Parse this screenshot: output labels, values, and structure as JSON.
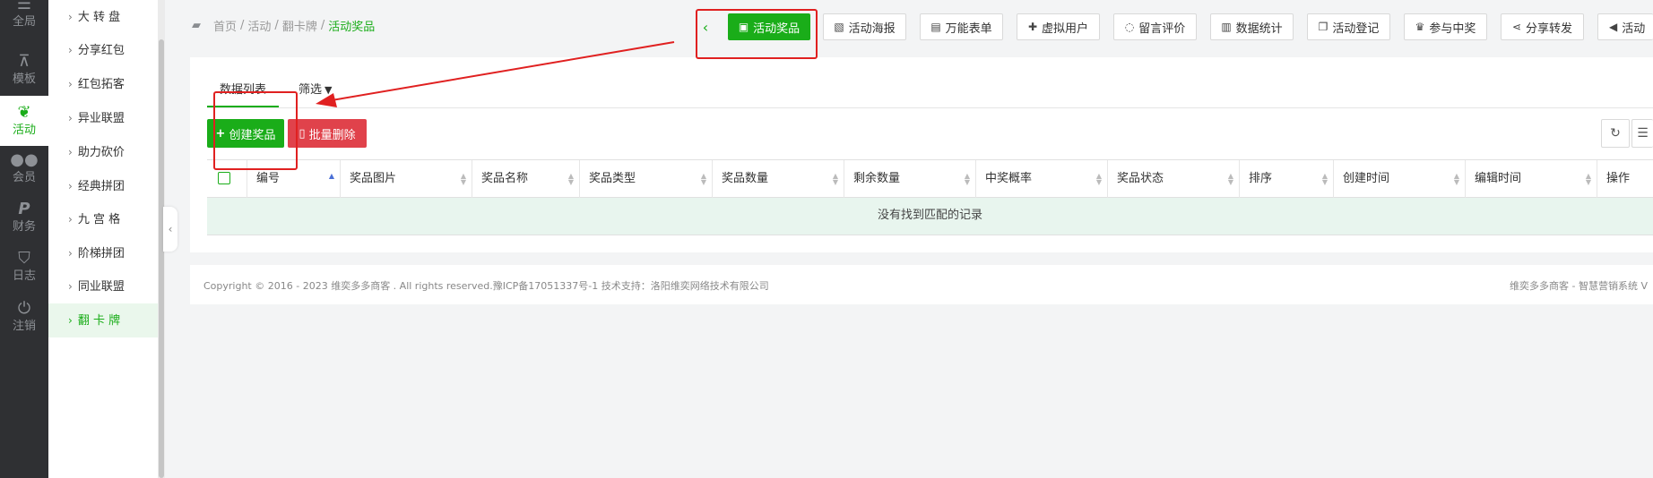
{
  "rail": {
    "items": [
      {
        "label": "全局",
        "icon": "sliders-icon"
      },
      {
        "label": "模板",
        "icon": "sitemap-icon"
      },
      {
        "label": "活动",
        "icon": "leaf-icon",
        "active": true
      },
      {
        "label": "会员",
        "icon": "users-icon"
      },
      {
        "label": "财务",
        "icon": "paypal-icon"
      },
      {
        "label": "日志",
        "icon": "shield-icon"
      },
      {
        "label": "注销",
        "icon": "power-icon"
      }
    ]
  },
  "submenu": {
    "items": [
      {
        "label": "大 转 盘"
      },
      {
        "label": "分享红包"
      },
      {
        "label": "红包拓客"
      },
      {
        "label": "异业联盟"
      },
      {
        "label": "助力砍价"
      },
      {
        "label": "经典拼团"
      },
      {
        "label": "九 宫 格"
      },
      {
        "label": "阶梯拼团"
      },
      {
        "label": "同业联盟"
      },
      {
        "label": "翻 卡 牌",
        "active": true
      }
    ]
  },
  "breadcrumb": {
    "items": [
      "首页",
      "活动",
      "翻卡牌"
    ],
    "current": "活动奖品"
  },
  "toolbar": {
    "buttons": [
      {
        "label": "活动奖品",
        "icon": "gift-icon",
        "active": true
      },
      {
        "label": "活动海报",
        "icon": "image-icon"
      },
      {
        "label": "万能表单",
        "icon": "file-icon"
      },
      {
        "label": "虚拟用户",
        "icon": "user-plus-icon"
      },
      {
        "label": "留言评价",
        "icon": "comment-icon"
      },
      {
        "label": "数据统计",
        "icon": "bar-chart-icon"
      },
      {
        "label": "活动登记",
        "icon": "copy-icon"
      },
      {
        "label": "参与中奖",
        "icon": "trophy-icon"
      },
      {
        "label": "分享转发",
        "icon": "share-icon"
      },
      {
        "label": "活动",
        "icon": "bullhorn-icon"
      }
    ]
  },
  "tabs": {
    "data_list": "数据列表",
    "filter": "筛选"
  },
  "actions": {
    "create": "创建奖品",
    "batch_delete": "批量删除"
  },
  "table": {
    "columns": [
      "编号",
      "奖品图片",
      "奖品名称",
      "奖品类型",
      "奖品数量",
      "剩余数量",
      "中奖概率",
      "奖品状态",
      "排序",
      "创建时间",
      "编辑时间",
      "操作"
    ],
    "empty_text": "没有找到匹配的记录"
  },
  "footer": {
    "copyright": "Copyright © 2016 - 2023 维奕多多商客 . All rights reserved.豫ICP备17051337号-1 技术支持：洛阳维奕网络技术有限公司",
    "right": "维奕多多商客 - 智慧营销系统 V"
  },
  "colors": {
    "accent": "#1aad19",
    "danger": "#e0424b",
    "rail_bg": "#2f3033",
    "annotation": "#e02020"
  }
}
